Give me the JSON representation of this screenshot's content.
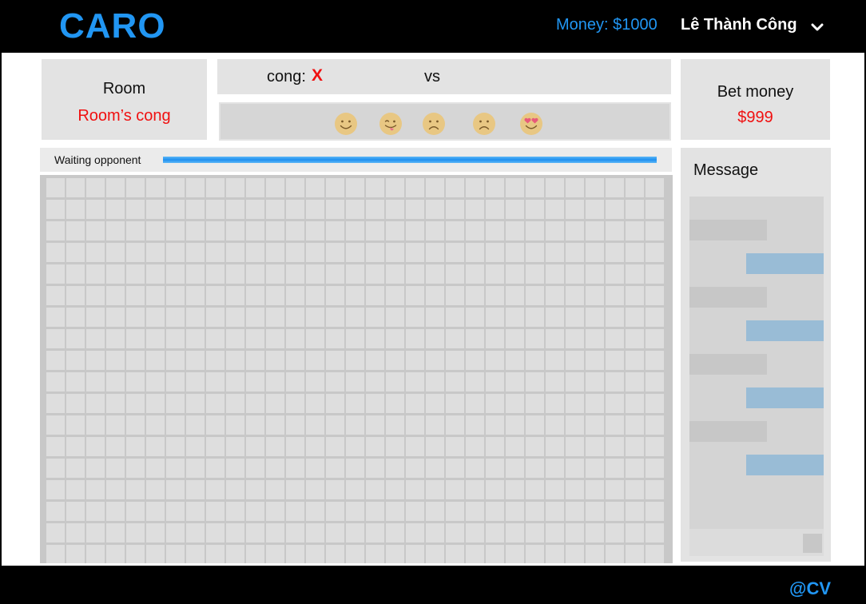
{
  "header": {
    "logo": "CARO",
    "money": "Money: $1000",
    "username": "Lê Thành Công",
    "menu_icon": "chevron-down-icon"
  },
  "room": {
    "label": "Room",
    "name": "Room’s cong"
  },
  "match": {
    "player_name": "cong:",
    "player_mark": "X",
    "vs_label": "vs"
  },
  "emojis": [
    "smile-emoji-icon",
    "tongue-out-emoji-icon",
    "sad-emoji-icon",
    "sad-emoji-icon",
    "heart-eyes-emoji-icon"
  ],
  "bet": {
    "label": "Bet money",
    "value": "$999"
  },
  "status": {
    "text": "Waiting opponent",
    "progress": 1.0
  },
  "board": {
    "columns": 31,
    "rows": 18
  },
  "chat": {
    "title": "Message",
    "messages": [
      "left",
      "right",
      "left",
      "right",
      "left",
      "right",
      "left",
      "right"
    ],
    "send_icon": "send-icon"
  },
  "footer": {
    "credit": "@CV"
  },
  "colors": {
    "accent": "#2196f3",
    "danger": "#f01010",
    "panel": "#e3e3e3",
    "emoji": "#e8c783"
  }
}
